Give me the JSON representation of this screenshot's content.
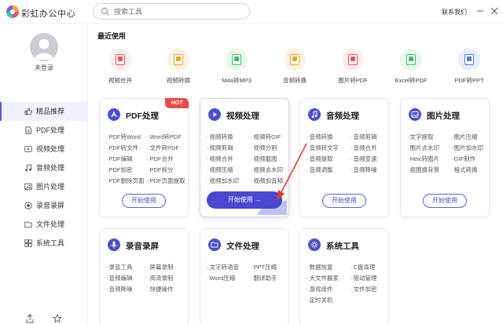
{
  "app": {
    "name": "彩虹办公中心",
    "contact": "联系我们"
  },
  "search": {
    "placeholder": "搜索工具"
  },
  "user": {
    "login_text": "未登录"
  },
  "sidebar": {
    "items": [
      {
        "label": "精品推荐",
        "icon": "thumb-up-icon",
        "active": true
      },
      {
        "label": "PDF处理",
        "icon": "pdf-doc-icon"
      },
      {
        "label": "视频处理",
        "icon": "video-icon"
      },
      {
        "label": "音频处理",
        "icon": "music-icon"
      },
      {
        "label": "图片处理",
        "icon": "image-icon"
      },
      {
        "label": "录音录屏",
        "icon": "record-icon"
      },
      {
        "label": "文件处理",
        "icon": "folder-icon"
      },
      {
        "label": "系统工具",
        "icon": "tools-icon"
      }
    ]
  },
  "recent": {
    "title": "最近使用",
    "items": [
      {
        "label": "视频合并",
        "color": "#e9555b",
        "bg": "#fdecee"
      },
      {
        "label": "视频转换",
        "color": "#f0a02a",
        "bg": "#fdf2e2"
      },
      {
        "label": "M4a转MP3",
        "color": "#3cbf6a",
        "bg": "#e6f7ec"
      },
      {
        "label": "音频转换",
        "color": "#f0a02a",
        "bg": "#fdf2e2"
      },
      {
        "label": "图片转PDF",
        "color": "#e9555b",
        "bg": "#fdecee"
      },
      {
        "label": "Excel转PDF",
        "color": "#3cbf6a",
        "bg": "#e6f7ec"
      },
      {
        "label": "PDF转PPT",
        "color": "#4a7be0",
        "bg": "#e8effc"
      }
    ]
  },
  "cards": {
    "pdf": {
      "title": "PDF处理",
      "badge": "HOT",
      "button": "开始使用",
      "features": [
        "PDF转Word",
        "Word转PDF",
        "PDF转文件",
        "文件转PDF",
        "PDF编辑",
        "PDF合并",
        "PDF加密",
        "PDF拆分",
        "PDF删除页面",
        "PDF页面提取"
      ]
    },
    "video": {
      "title": "视频处理",
      "button": "开始使用 →",
      "features": [
        "视频转换",
        "视频转GIF",
        "视频剪辑",
        "视频分割",
        "视频合并",
        "视频截图",
        "视频压缩",
        "视频去水印",
        "视频加水印",
        "视频加音频"
      ]
    },
    "audio": {
      "title": "音频处理",
      "button": "开始使用",
      "features": [
        "音频转换",
        "音频剪辑",
        "音频转文字",
        "音频合并",
        "音频提取",
        "音频变速",
        "音频调整",
        "音频降噪"
      ]
    },
    "image": {
      "title": "图片处理",
      "button": "开始使用",
      "features": [
        "文字提取",
        "图片压缩",
        "图片去水印",
        "图片加水印",
        "Heic转图片",
        "GIF制作",
        "抠图换背景",
        "格式转换"
      ]
    },
    "record": {
      "title": "录音录屏",
      "features": [
        "录音工具",
        "屏幕录制",
        "音频编辑",
        "高清录制",
        "音频降噪",
        "快捷操作"
      ]
    },
    "file": {
      "title": "文件处理",
      "features": [
        "文字转语音",
        "PPT压缩",
        "Word压缩",
        "翻译助手"
      ]
    },
    "system": {
      "title": "系统工具",
      "features": [
        "数据恢复",
        "C盘清理",
        "大文件搬家",
        "驱动管理",
        "游戏组件",
        "文件加密",
        "定时关机"
      ]
    }
  },
  "colors": {
    "accent": "#4a47d2",
    "hot": "#ec4b49"
  }
}
